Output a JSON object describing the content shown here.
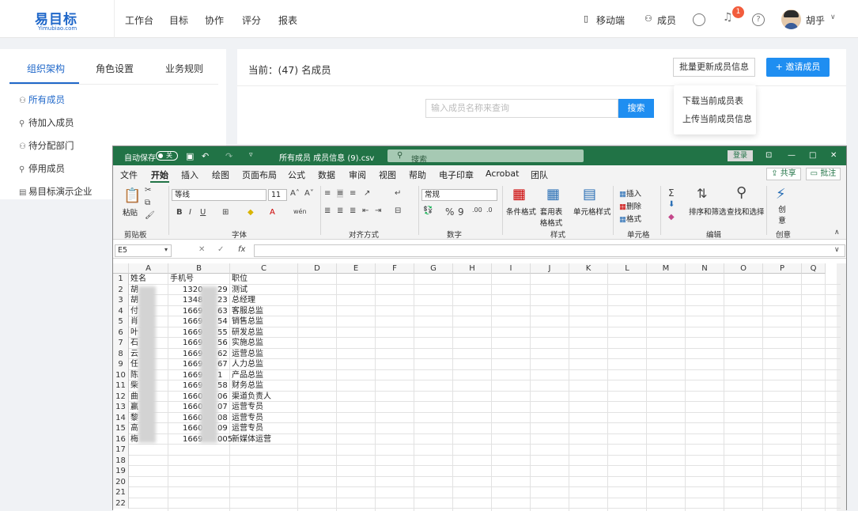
{
  "logo": {
    "text": "易目标",
    "sub": "Yimubiao.com"
  },
  "nav": [
    "工作台",
    "目标",
    "协作",
    "评分",
    "报表"
  ],
  "topright": {
    "mobile": "移动端",
    "members": "成员",
    "badge": "1",
    "user": "胡乎"
  },
  "left": {
    "tabs": [
      "组织架构",
      "角色设置",
      "业务规则"
    ],
    "items": [
      {
        "icon": "members-icon",
        "label": "所有成员"
      },
      {
        "icon": "user-add-icon",
        "label": "待加入成员"
      },
      {
        "icon": "users-icon",
        "label": "待分配部门"
      },
      {
        "icon": "user-stop-icon",
        "label": "停用成员"
      },
      {
        "icon": "building-icon",
        "label": "易目标演示企业"
      }
    ]
  },
  "main": {
    "current": "当前：(47) 名成员",
    "batch_update": "批量更新成员信息",
    "invite": "+ 邀请成员",
    "search_placeholder": "输入成员名称来查询",
    "search_btn": "搜索",
    "dropdown": [
      "下载当前成员表",
      "上传当前成员信息"
    ]
  },
  "excel": {
    "autosave": "自动保存",
    "toggle": "关",
    "filename": "所有成员 成员信息 (9).csv",
    "search": "搜索",
    "login": "登录",
    "menu": [
      "文件",
      "开始",
      "插入",
      "绘图",
      "页面布局",
      "公式",
      "数据",
      "审阅",
      "视图",
      "帮助",
      "电子印章",
      "Acrobat",
      "团队"
    ],
    "share": "共享",
    "comment": "批注",
    "ribbon": {
      "paste": "粘贴",
      "font_name": "等线",
      "font_size": "11",
      "number_format": "常规",
      "cond_format": "条件格式",
      "table_format": "套用表格格式",
      "cell_style": "单元格样式",
      "insert": "插入",
      "delete": "删除",
      "format": "格式",
      "sort_filter": "排序和筛选",
      "find_select": "查找和选择",
      "create": "创意",
      "groups": [
        "剪贴板",
        "字体",
        "对齐方式",
        "数字",
        "样式",
        "单元格",
        "编辑",
        "创意"
      ]
    },
    "namebox": "E5",
    "columns": [
      "A",
      "B",
      "C",
      "D",
      "E",
      "F",
      "G",
      "H",
      "I",
      "J",
      "K",
      "L",
      "M",
      "N",
      "O",
      "P",
      "Q"
    ],
    "rows": [
      "1",
      "2",
      "3",
      "4",
      "5",
      "6",
      "7",
      "8",
      "9",
      "10",
      "11",
      "12",
      "13",
      "14",
      "15",
      "16",
      "17",
      "18",
      "19",
      "20",
      "21",
      "22"
    ],
    "headers": [
      "姓名",
      "手机号",
      "职位"
    ],
    "data": [
      [
        "胡",
        "132029",
        "测试"
      ],
      [
        "胡",
        "134823",
        "总经理"
      ],
      [
        "付",
        "166963",
        "客服总监"
      ],
      [
        "肖",
        "166954",
        "销售总监"
      ],
      [
        "叶",
        "166955",
        "研发总监"
      ],
      [
        "石",
        "166956",
        "实施总监"
      ],
      [
        "云",
        "166962",
        "运营总监"
      ],
      [
        "任",
        "166967",
        "人力总监"
      ],
      [
        "陈",
        "16691",
        "产品总监"
      ],
      [
        "柴",
        "166958",
        "财务总监"
      ],
      [
        "曲",
        "166006",
        "渠道负责人"
      ],
      [
        "赢",
        "166007",
        "运营专员"
      ],
      [
        "黎",
        "166008",
        "运营专员"
      ],
      [
        "高",
        "166009",
        "运营专员"
      ],
      [
        "梅",
        "1669005",
        "新媒体运营"
      ]
    ]
  }
}
